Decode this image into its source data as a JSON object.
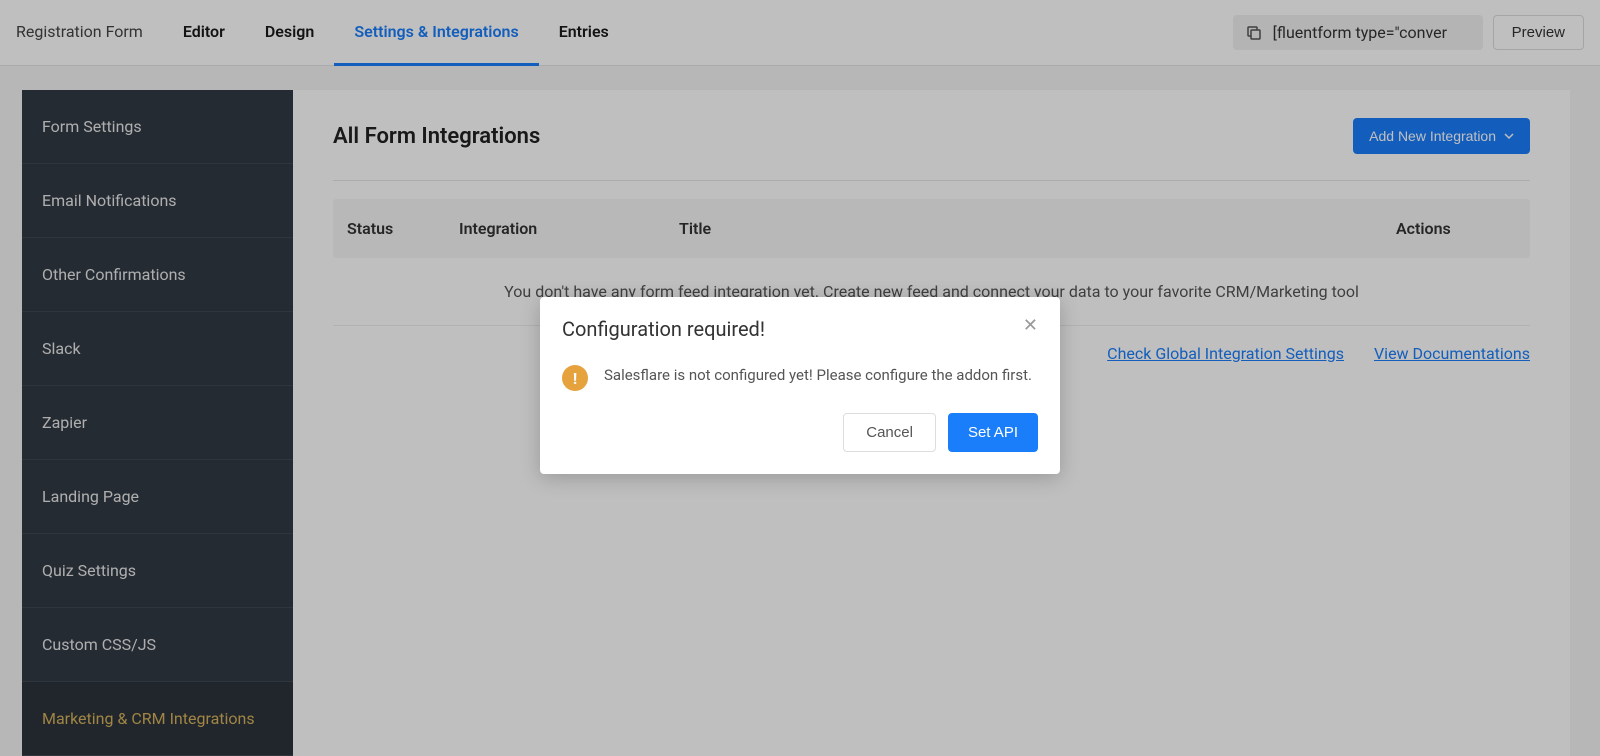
{
  "topbar": {
    "nav": [
      {
        "label": "Registration Form",
        "active": false
      },
      {
        "label": "Editor",
        "active": false
      },
      {
        "label": "Design",
        "active": false
      },
      {
        "label": "Settings & Integrations",
        "active": true
      },
      {
        "label": "Entries",
        "active": false
      }
    ],
    "shortcode": "[fluentform type=\"conver",
    "preview_label": "Preview"
  },
  "sidebar": {
    "items": [
      "Form Settings",
      "Email Notifications",
      "Other Confirmations",
      "Slack",
      "Zapier",
      "Landing Page",
      "Quiz Settings",
      "Custom CSS/JS",
      "Marketing & CRM Integrations"
    ]
  },
  "content": {
    "title": "All Form Integrations",
    "add_label": "Add New Integration",
    "table": {
      "headers": {
        "status": "Status",
        "integration": "Integration",
        "title": "Title",
        "actions": "Actions"
      },
      "empty_msg": "You don't have any form feed integration yet. Create new feed and connect your data to your favorite CRM/Marketing tool"
    },
    "links": {
      "global": "Check Global Integration Settings",
      "docs": "View Documentations"
    }
  },
  "modal": {
    "title": "Configuration required!",
    "body": "Salesflare is not configured yet! Please configure the addon first.",
    "cancel": "Cancel",
    "confirm": "Set API"
  }
}
